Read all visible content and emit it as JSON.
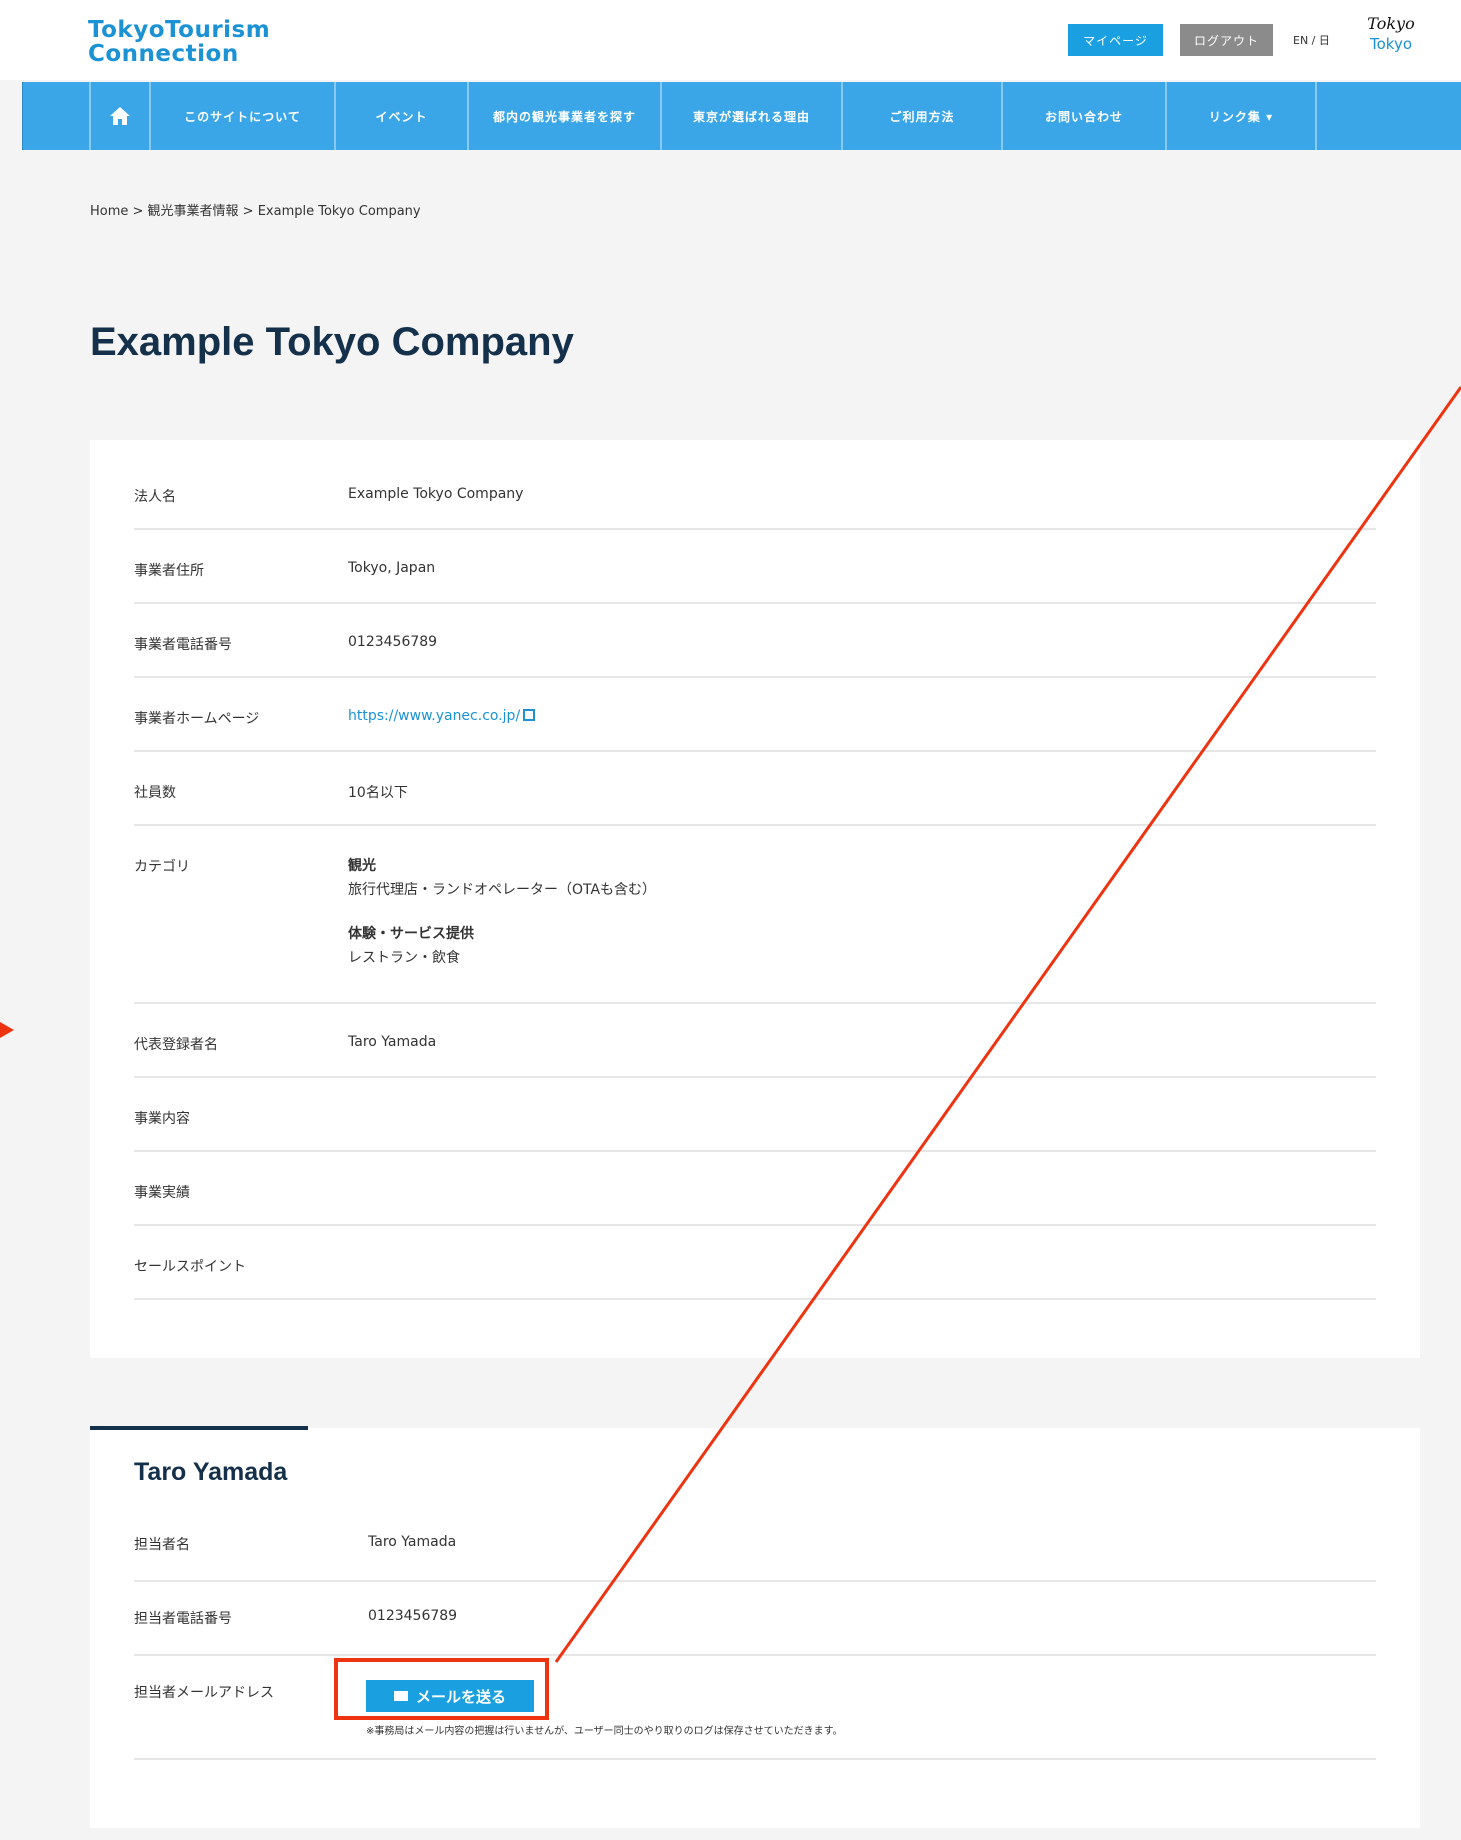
{
  "header": {
    "logo_line1": "TokyoTourism",
    "logo_line2": "Connection",
    "mypage_label": "マイページ",
    "logout_label": "ログアウト",
    "lang_label": "EN / 日",
    "tt_logo_line1": "Tokyo",
    "tt_logo_line2": "Tokyo"
  },
  "nav": {
    "home_icon": "home-icon",
    "items": [
      "このサイトについて",
      "イベント",
      "都内の観光事業者を探す",
      "東京が選ばれる理由",
      "ご利用方法",
      "お問い合わせ",
      "リンク集 ▾"
    ]
  },
  "breadcrumb": "Home > 観光事業者情報 > Example Tokyo Company",
  "page_title": "Example Tokyo Company",
  "company": {
    "rows": [
      {
        "label": "法人名",
        "value": "Example Tokyo Company"
      },
      {
        "label": "事業者住所",
        "value": "Tokyo, Japan"
      },
      {
        "label": "事業者電話番号",
        "value": "0123456789"
      },
      {
        "label": "事業者ホームページ",
        "value": "https://www.yanec.co.jp/"
      },
      {
        "label": "社員数",
        "value": "10名以下"
      },
      {
        "label": "カテゴリ",
        "value": ""
      },
      {
        "label": "代表登録者名",
        "value": "Taro Yamada"
      },
      {
        "label": "事業内容",
        "value": ""
      },
      {
        "label": "事業実績",
        "value": ""
      },
      {
        "label": "セールスポイント",
        "value": ""
      }
    ],
    "categories": [
      {
        "head": "観光",
        "sub": "旅行代理店・ランドオペレーター（OTAも含む）"
      },
      {
        "head": "体験・サービス提供",
        "sub": "レストラン・飲食"
      }
    ]
  },
  "contact": {
    "name": "Taro Yamada",
    "rows": [
      {
        "label": "担当者名",
        "value": "Taro Yamada"
      },
      {
        "label": "担当者電話番号",
        "value": "0123456789"
      },
      {
        "label": "担当者メールアドレス",
        "value": ""
      }
    ],
    "mail_button": "メールを送る",
    "note": "※事務局はメール内容の把握は行いませんが、ユーザー同士のやり取りのログは保存させていただきます。"
  },
  "colors": {
    "accent": "#1aa0e0",
    "nav_bg": "#3aa6e8",
    "title": "#14304a",
    "annotation": "#ee3311"
  }
}
